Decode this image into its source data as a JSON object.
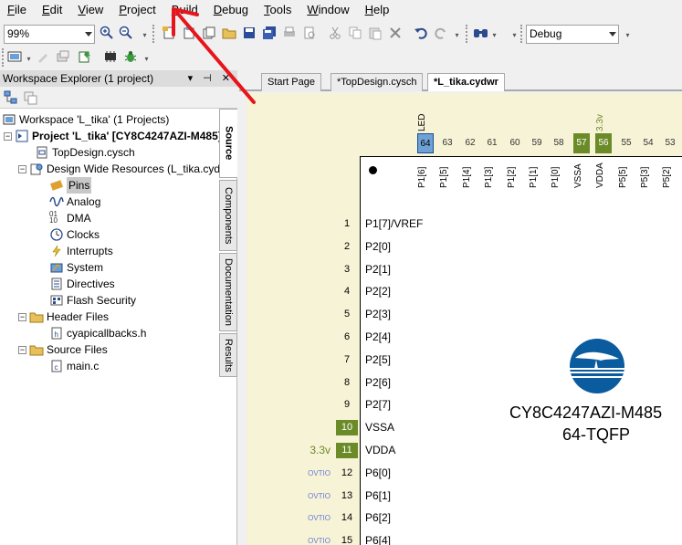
{
  "menu": [
    "File",
    "Edit",
    "View",
    "Project",
    "Build",
    "Debug",
    "Tools",
    "Window",
    "Help"
  ],
  "toolbar": {
    "zoom_value": "99%",
    "config_value": "Debug"
  },
  "explorer": {
    "title": "Workspace Explorer (1 project)",
    "workspace": "Workspace 'L_tika' (1 Projects)",
    "project": "Project  'L_tika' [CY8C4247AZI-M485]",
    "topdesign": "TopDesign.cysch",
    "dwr": "Design Wide Resources (L_tika.cydwr)",
    "dwr_items": [
      "Pins",
      "Analog",
      "DMA",
      "Clocks",
      "Interrupts",
      "System",
      "Directives",
      "Flash Security"
    ],
    "header_files": "Header Files",
    "header_items": [
      "cyapicallbacks.h"
    ],
    "source_files": "Source Files",
    "source_items": [
      "main.c"
    ]
  },
  "side_tabs": [
    "Source",
    "Components",
    "Documentation",
    "Results"
  ],
  "doc_tabs": [
    "Start Page",
    "*TopDesign.cysch",
    "*L_tika.cydwr"
  ],
  "chip": {
    "name": "CY8C4247AZI-M485",
    "package": "64-TQFP",
    "top_pins": [
      {
        "num": "64",
        "name": "P1[6]",
        "label": "LED",
        "state": "selected"
      },
      {
        "num": "63",
        "name": "P1[5]",
        "label": "",
        "state": ""
      },
      {
        "num": "62",
        "name": "P1[4]",
        "label": "",
        "state": ""
      },
      {
        "num": "61",
        "name": "P1[3]",
        "label": "",
        "state": ""
      },
      {
        "num": "60",
        "name": "P1[2]",
        "label": "",
        "state": ""
      },
      {
        "num": "59",
        "name": "P1[1]",
        "label": "",
        "state": ""
      },
      {
        "num": "58",
        "name": "P1[0]",
        "label": "",
        "state": ""
      },
      {
        "num": "57",
        "name": "VSSA",
        "label": "",
        "state": "power"
      },
      {
        "num": "56",
        "name": "VDDA",
        "label": "3.3v",
        "state": "power"
      },
      {
        "num": "55",
        "name": "P5[5]",
        "label": "",
        "state": ""
      },
      {
        "num": "54",
        "name": "P5[3]",
        "label": "",
        "state": ""
      },
      {
        "num": "53",
        "name": "P5[2]",
        "label": "",
        "state": ""
      }
    ],
    "left_pins": [
      {
        "num": "1",
        "name": "P1[7]/VREF",
        "label": "",
        "state": ""
      },
      {
        "num": "2",
        "name": "P2[0]",
        "label": "",
        "state": ""
      },
      {
        "num": "3",
        "name": "P2[1]",
        "label": "",
        "state": ""
      },
      {
        "num": "4",
        "name": "P2[2]",
        "label": "",
        "state": ""
      },
      {
        "num": "5",
        "name": "P2[3]",
        "label": "",
        "state": ""
      },
      {
        "num": "6",
        "name": "P2[4]",
        "label": "",
        "state": ""
      },
      {
        "num": "7",
        "name": "P2[5]",
        "label": "",
        "state": ""
      },
      {
        "num": "8",
        "name": "P2[6]",
        "label": "",
        "state": ""
      },
      {
        "num": "9",
        "name": "P2[7]",
        "label": "",
        "state": ""
      },
      {
        "num": "10",
        "name": "VSSA",
        "label": "",
        "state": "power"
      },
      {
        "num": "11",
        "name": "VDDA",
        "label": "3.3v",
        "state": "power"
      },
      {
        "num": "12",
        "name": "P6[0]",
        "label": "OVTIO",
        "state": "ovtio"
      },
      {
        "num": "13",
        "name": "P6[1]",
        "label": "OVTIO",
        "state": "ovtio"
      },
      {
        "num": "14",
        "name": "P6[2]",
        "label": "OVTIO",
        "state": "ovtio"
      },
      {
        "num": "15",
        "name": "P6[4]",
        "label": "OVTIO",
        "state": "ovtio"
      }
    ]
  },
  "colors": {
    "power_green": "#6b8b29",
    "selected_blue": "#6ea1d6",
    "canvas_bg": "#f7f3d7",
    "annotation_arrow": "#e8141c",
    "logo_blue": "#0a5c9e"
  }
}
